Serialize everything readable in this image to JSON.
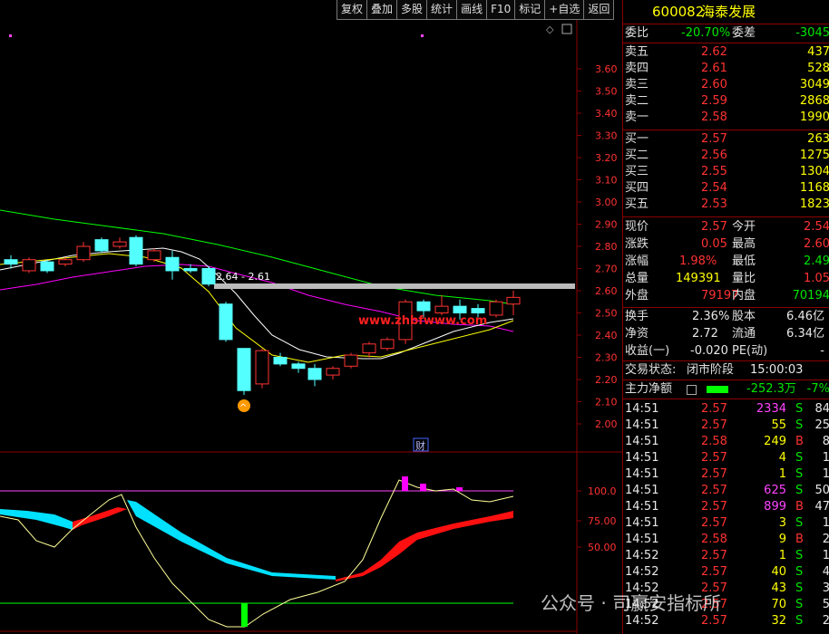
{
  "toolbar": [
    "复权",
    "叠加",
    "多股",
    "统计",
    "画线",
    "F10",
    "标记",
    "+自选",
    "返回"
  ],
  "stock": {
    "code": "600082",
    "name": "海泰发展"
  },
  "weibi": {
    "label1": "委比",
    "value1": "-20.70%",
    "label2": "委差",
    "value2": "-3045"
  },
  "sell": [
    {
      "label": "卖五",
      "price": "2.62",
      "vol": "437"
    },
    {
      "label": "卖四",
      "price": "2.61",
      "vol": "528"
    },
    {
      "label": "卖三",
      "price": "2.60",
      "vol": "3049"
    },
    {
      "label": "卖二",
      "price": "2.59",
      "vol": "2868"
    },
    {
      "label": "卖一",
      "price": "2.58",
      "vol": "1990"
    }
  ],
  "buy": [
    {
      "label": "买一",
      "price": "2.57",
      "vol": "263"
    },
    {
      "label": "买二",
      "price": "2.56",
      "vol": "1275"
    },
    {
      "label": "买三",
      "price": "2.55",
      "vol": "1304"
    },
    {
      "label": "买四",
      "price": "2.54",
      "vol": "1168"
    },
    {
      "label": "买五",
      "price": "2.53",
      "vol": "1823"
    }
  ],
  "quote": [
    {
      "l1": "现价",
      "v1": "2.57",
      "c1": "red",
      "l2": "今开",
      "v2": "2.54",
      "c2": "red"
    },
    {
      "l1": "涨跌",
      "v1": "0.05",
      "c1": "red",
      "l2": "最高",
      "v2": "2.60",
      "c2": "red"
    },
    {
      "l1": "涨幅",
      "v1": "1.98%",
      "c1": "red",
      "l2": "最低",
      "v2": "2.49",
      "c2": "green"
    },
    {
      "l1": "总量",
      "v1": "149391",
      "c1": "yellow",
      "l2": "量比",
      "v2": "1.05",
      "c2": "red"
    },
    {
      "l1": "外盘",
      "v1": "79197",
      "c1": "red",
      "l2": "内盘",
      "v2": "70194",
      "c2": "green"
    }
  ],
  "fin": [
    {
      "l1": "换手",
      "v1": "2.36%",
      "l2": "股本",
      "v2": "6.46亿"
    },
    {
      "l1": "净资",
      "v1": "2.72",
      "l2": "流通",
      "v2": "6.34亿"
    },
    {
      "l1": "收益(一)",
      "v1": "-0.020",
      "l2": "PE(动)",
      "v2": "-"
    }
  ],
  "status": {
    "label": "交易状态:",
    "value": "闭市阶段",
    "time": "15:00:03"
  },
  "main_net": {
    "label": "主力净额",
    "value": "-252.3万",
    "pct": "-7%"
  },
  "ticks": [
    {
      "t": "14:51",
      "p": "2.57",
      "v": "2334",
      "bs": "S",
      "n": "84"
    },
    {
      "t": "14:51",
      "p": "2.57",
      "v": "55",
      "bs": "S",
      "n": "25"
    },
    {
      "t": "14:51",
      "p": "2.58",
      "v": "249",
      "bs": "B",
      "n": "8"
    },
    {
      "t": "14:51",
      "p": "2.57",
      "v": "4",
      "bs": "S",
      "n": "1"
    },
    {
      "t": "14:51",
      "p": "2.57",
      "v": "1",
      "bs": "S",
      "n": "1"
    },
    {
      "t": "14:51",
      "p": "2.57",
      "v": "625",
      "bs": "S",
      "n": "50"
    },
    {
      "t": "14:51",
      "p": "2.57",
      "v": "899",
      "bs": "B",
      "n": "47"
    },
    {
      "t": "14:51",
      "p": "2.57",
      "v": "3",
      "bs": "S",
      "n": "1"
    },
    {
      "t": "14:51",
      "p": "2.58",
      "v": "9",
      "bs": "B",
      "n": "2"
    },
    {
      "t": "14:52",
      "p": "2.57",
      "v": "1",
      "bs": "S",
      "n": "1"
    },
    {
      "t": "14:52",
      "p": "2.57",
      "v": "40",
      "bs": "S",
      "n": "4"
    },
    {
      "t": "14:52",
      "p": "2.57",
      "v": "43",
      "bs": "S",
      "n": "3"
    },
    {
      "t": "14:52",
      "p": "2.57",
      "v": "70",
      "bs": "S",
      "n": "5"
    },
    {
      "t": "14:52",
      "p": "2.57",
      "v": "32",
      "bs": "S",
      "n": "2"
    }
  ],
  "price_axis": [
    "3.60",
    "3.50",
    "3.40",
    "3.30",
    "3.20",
    "3.10",
    "3.00",
    "2.90",
    "2.80",
    "2.70",
    "2.60",
    "2.50",
    "2.40",
    "2.30",
    "2.20",
    "2.10",
    "2.00"
  ],
  "indicator_axis": [
    "100.0",
    "75.00",
    "50.00"
  ],
  "price_line_label": "2.64 - 2.61",
  "fin_marker": "财",
  "overlay_text": "www.zhbfwww.com",
  "watermark_text": "公众号 · 司赢安指标所",
  "colors": {
    "up": "#ff3232",
    "down": "#54ffff",
    "ma1": "#ffffff",
    "ma2": "#ffff00",
    "ma3": "#ff00ff",
    "ma4": "#00ff00"
  }
}
